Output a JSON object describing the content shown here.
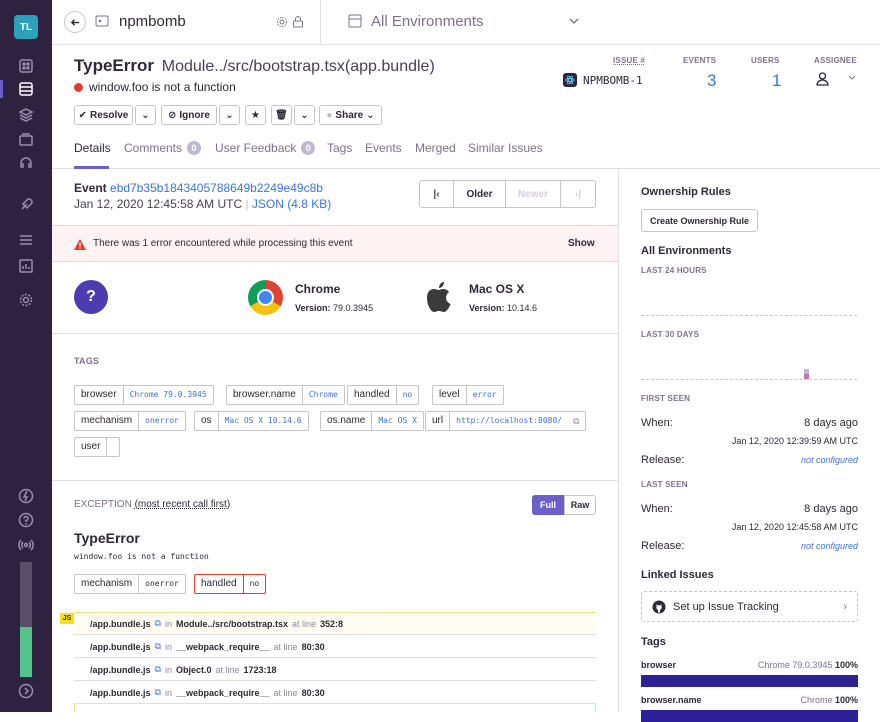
{
  "sidebar": {
    "org_initials": "TL",
    "accent": "#2f2240",
    "avatar_color": "#2ba2ba"
  },
  "topbar": {
    "project": "npmbomb",
    "environments": "All Environments"
  },
  "issue": {
    "type": "TypeError",
    "culprit": "Module../src/bootstrap.tsx(app.bundle)",
    "message": "window.foo is not a function",
    "status_color": "#e03e2f"
  },
  "stats": {
    "issue_label": "ISSUE #",
    "issue_id": "NPMBOMB-1",
    "events_label": "EVENTS",
    "events": "3",
    "users_label": "USERS",
    "users": "1",
    "assignee_label": "ASSIGNEE"
  },
  "actions": {
    "resolve": "Resolve",
    "ignore": "Ignore",
    "share": "Share"
  },
  "tabs": {
    "details": "Details",
    "comments": "Comments",
    "comments_count": "0",
    "feedback": "User Feedback",
    "feedback_count": "0",
    "tags": "Tags",
    "events": "Events",
    "merged": "Merged",
    "similar": "Similar Issues"
  },
  "event": {
    "label": "Event",
    "id": "ebd7b35b1843405788649b2249e49c8b",
    "date": "Jan 12, 2020 12:45:58 AM UTC",
    "sep": "|",
    "json": "JSON (4.8 KB)",
    "older": "Older",
    "newer": "Newer"
  },
  "error_banner": {
    "text": "There was 1 error encountered while processing this event",
    "show": "Show"
  },
  "context": {
    "unknown": "?",
    "browser_name": "Chrome",
    "browser_version_label": "Version:",
    "browser_version": "79.0.3945",
    "os_name": "Mac OS X",
    "os_version_label": "Version:",
    "os_version": "10.14.6"
  },
  "tags_section": {
    "title": "TAGS",
    "items": [
      {
        "k": "browser",
        "v": "Chrome 79.0.3945"
      },
      {
        "k": "browser.name",
        "v": "Chrome"
      },
      {
        "k": "handled",
        "v": "no"
      },
      {
        "k": "level",
        "v": "error"
      },
      {
        "k": "mechanism",
        "v": "onerror"
      },
      {
        "k": "os",
        "v": "Mac OS X 10.14.6"
      },
      {
        "k": "os.name",
        "v": "Mac OS X"
      },
      {
        "k": "url",
        "v": "http://localhost:8080/"
      },
      {
        "k": "user",
        "v": ""
      }
    ]
  },
  "exception": {
    "title": "EXCEPTION",
    "subtitle": "(most recent call first)",
    "full": "Full",
    "raw": "Raw",
    "type": "TypeError",
    "value": "window.foo is not a function",
    "mech_k": "mechanism",
    "mech_v": "onerror",
    "handled_k": "handled",
    "handled_v": "no",
    "platform": "JS",
    "frames": [
      {
        "file": "/app.bundle.js",
        "in": "in",
        "fn": "Module../src/bootstrap.tsx",
        "at": "at line",
        "line": "352:8"
      },
      {
        "file": "/app.bundle.js",
        "in": "in",
        "fn": "__webpack_require__",
        "at": "at line",
        "line": "80:30"
      },
      {
        "file": "/app.bundle.js",
        "in": "in",
        "fn": "Object.0",
        "at": "at line",
        "line": "1723:18"
      },
      {
        "file": "/app.bundle.js",
        "in": "in",
        "fn": "__webpack_require__",
        "at": "at line",
        "line": "80:30"
      }
    ]
  },
  "right": {
    "ownership": "Ownership Rules",
    "create_rule": "Create Ownership Rule",
    "all_env": "All Environments",
    "last24": "LAST 24 HOURS",
    "last30": "LAST 30 DAYS",
    "first_seen": "FIRST SEEN",
    "when": "When:",
    "first_when": "8 days ago",
    "first_date": "Jan 12, 2020 12:39:59 AM UTC",
    "release": "Release:",
    "not_configured": "not configured",
    "last_seen": "LAST SEEN",
    "last_when": "8 days ago",
    "last_date": "Jan 12, 2020 12:45:58 AM UTC",
    "linked": "Linked Issues",
    "tracking": "Set up Issue Tracking",
    "tags": "Tags",
    "tag_rows": [
      {
        "k": "browser",
        "v": "Chrome 79.0.3945",
        "pct": "100%",
        "fill": 1.0
      },
      {
        "k": "browser.name",
        "v": "Chrome",
        "pct": "100%",
        "fill": 1.0
      }
    ],
    "bar_color": "#2e2097"
  }
}
